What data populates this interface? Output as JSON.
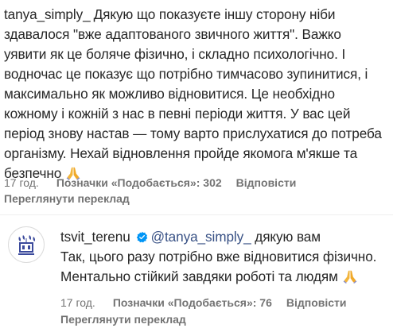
{
  "comment": {
    "username": "tanya_simply_",
    "text": "Дякую що показуєте іншу сторону ніби здавалося \"вже адаптованого звичного життя\". Важко уявити як це боляче фізично, і складно психологічно. І водночас це показує що потрібно тимчасово зупинитися, і максимально як можливо відновитися. Це необхідно кожному і кожній з нас в певні періоди життя. У вас цей період знову настав — тому варто прислухатися до потреба організму. Нехай відновлення пройде якомога м'якше та безпечно",
    "emoji": "folded-hands",
    "time": "17 год.",
    "likes": "Позначки «Подобається»: 302",
    "reply_label": "Відповісти",
    "translate_label": "Переглянути переклад"
  },
  "reply": {
    "username": "tsvit_terenu",
    "verified": true,
    "mention": "@tanya_simply_",
    "text_inline": "дякую вам",
    "text": "Так, цього разу потрібно вже відновитися фізично. Ментально стійкий завдяки роботі та людям",
    "emoji": "folded-hands",
    "time": "17 год.",
    "likes": "Позначки «Подобається»: 76",
    "reply_label": "Відповісти",
    "translate_label": "Переглянути переклад"
  },
  "colors": {
    "text": "#262626",
    "muted": "#737373",
    "mention": "#385185",
    "verified": "#0095f6",
    "emoji": "#f2b53c"
  }
}
